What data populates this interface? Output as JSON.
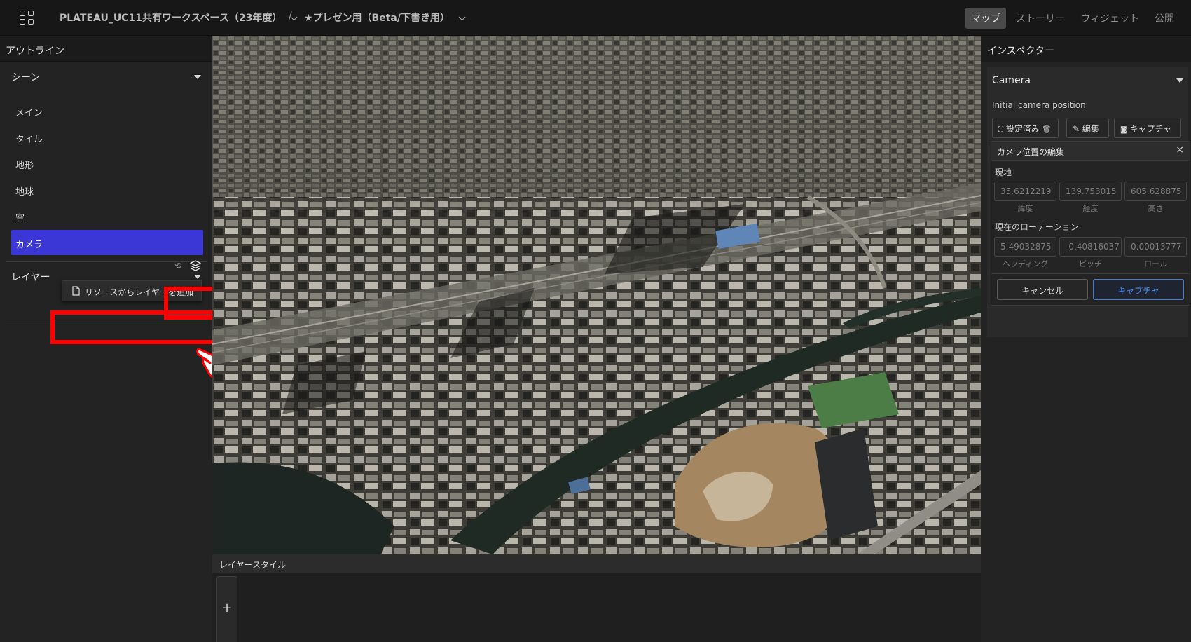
{
  "header": {
    "workspace": "PLATEAU_UC11共有ワークスペース（23年度）",
    "separator": "/",
    "project": "★プレゼン用（Beta/下書き用）",
    "tabs": [
      "マップ",
      "ストーリー",
      "ウィジェット",
      "公開"
    ],
    "active_tab": "マップ"
  },
  "outline": {
    "title": "アウトライン",
    "scene_label": "シーン",
    "scene_items": [
      "メイン",
      "タイル",
      "地形",
      "地球",
      "空",
      "カメラ"
    ],
    "selected_item": "カメラ",
    "layer_label": "レイヤー",
    "add_layer_menu_item": "リソースからレイヤーを追加"
  },
  "bottom_panel": {
    "title": "レイヤースタイル",
    "add_button": "+"
  },
  "inspector": {
    "title": "インスペクター",
    "section": "Camera",
    "initial_camera_label": "Initial camera position",
    "set_button": "設定済み",
    "edit_button": "編集",
    "capture_button": "キャプチャ",
    "edit_popup": {
      "title": "カメラ位置の編集",
      "close": "×",
      "current_location_label": "現地",
      "location_values": [
        "35.6212219",
        "139.753015",
        "605.628875"
      ],
      "location_captions": [
        "緯度",
        "経度",
        "高さ"
      ],
      "rotation_label": "現在のローテーション",
      "rotation_values": [
        "5.49032875",
        "-0.40816037",
        "0.00013777"
      ],
      "rotation_captions": [
        "ヘッディング",
        "ピッチ",
        "ロール"
      ],
      "cancel_button": "キャンセル",
      "capture_button": "キャプチャ"
    }
  },
  "colors": {
    "accent": "#3b37d6",
    "capture_blue": "#4a90ff",
    "callout_red": "#ff0000"
  }
}
